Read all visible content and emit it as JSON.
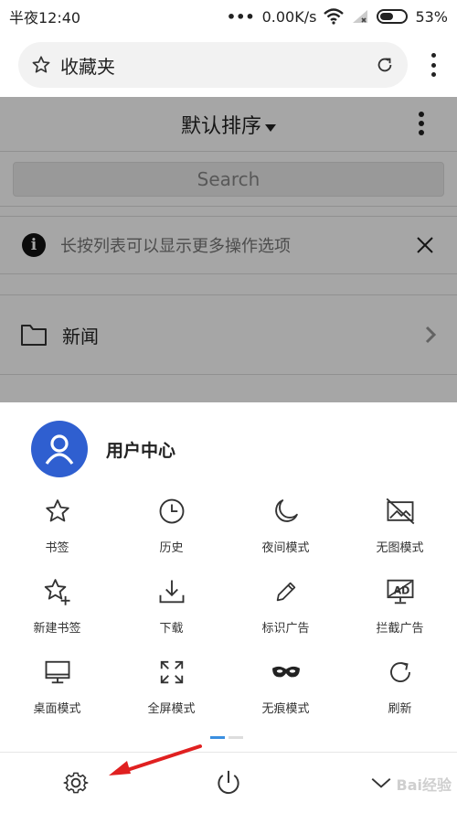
{
  "status_bar": {
    "time": "半夜12:40",
    "network_speed": "0.00K/s",
    "battery_percent": "53%"
  },
  "address_bar": {
    "title": "收藏夹"
  },
  "bookmarks_page": {
    "sort_label": "默认排序",
    "search_placeholder": "Search",
    "tip_text": "长按列表可以显示更多操作选项",
    "folder_name": "新闻"
  },
  "menu_sheet": {
    "user_center_label": "用户中心",
    "items": [
      {
        "label": "书签",
        "icon": "star-icon"
      },
      {
        "label": "历史",
        "icon": "clock-icon"
      },
      {
        "label": "夜间模式",
        "icon": "moon-icon"
      },
      {
        "label": "无图模式",
        "icon": "no-image-icon"
      },
      {
        "label": "新建书签",
        "icon": "star-plus-icon"
      },
      {
        "label": "下载",
        "icon": "download-icon"
      },
      {
        "label": "标识广告",
        "icon": "pencil-icon"
      },
      {
        "label": "拦截广告",
        "icon": "ad-block-icon"
      },
      {
        "label": "桌面模式",
        "icon": "desktop-icon"
      },
      {
        "label": "全屏模式",
        "icon": "fullscreen-icon"
      },
      {
        "label": "无痕模式",
        "icon": "mask-icon"
      },
      {
        "label": "刷新",
        "icon": "refresh-icon"
      }
    ],
    "page_count": 2,
    "active_page": 1
  },
  "bottom_bar": {
    "icons": [
      "gear-icon",
      "power-icon",
      "chevron-down-icon"
    ]
  },
  "watermark": "Bai经验",
  "colors": {
    "accent": "#3b8fe0",
    "avatar_bg": "#2f5fd0",
    "annotation_arrow": "#e02020"
  }
}
